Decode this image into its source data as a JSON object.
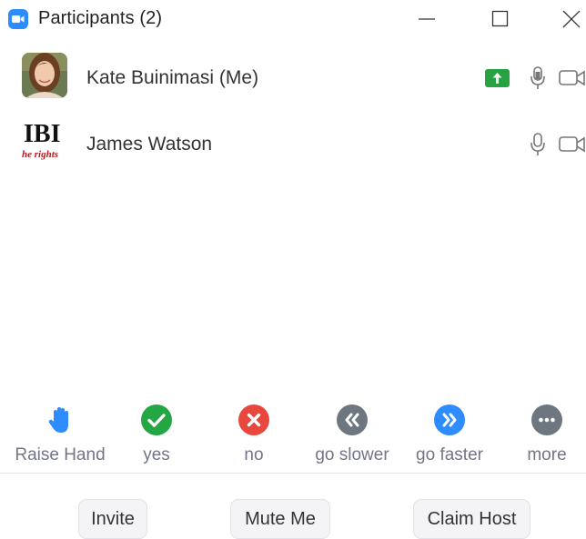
{
  "window": {
    "title": "Participants (2)"
  },
  "participants": [
    {
      "name": "Kate Buinimasi (Me)",
      "sharing": true,
      "avatar": "photo"
    },
    {
      "name": "James Watson",
      "sharing": false,
      "avatar_text": "IBI",
      "avatar_subtext": "he rights"
    }
  ],
  "reactions": [
    {
      "label": "Raise Hand",
      "icon": "raise-hand-icon",
      "color": "#2D8CFF"
    },
    {
      "label": "yes",
      "icon": "checkmark-icon",
      "color": "#23A643"
    },
    {
      "label": "no",
      "icon": "x-icon",
      "color": "#E8473E"
    },
    {
      "label": "go slower",
      "icon": "rewind-icon",
      "color": "#6E7680"
    },
    {
      "label": "go faster",
      "icon": "fast-forward-icon",
      "color": "#2D8CFF"
    },
    {
      "label": "more",
      "icon": "ellipsis-icon",
      "color": "#6E7680"
    }
  ],
  "buttons": {
    "invite": "Invite",
    "mute": "Mute Me",
    "claim_host": "Claim Host"
  },
  "colors": {
    "accent": "#2D8CFF",
    "share_green": "#27A243"
  }
}
